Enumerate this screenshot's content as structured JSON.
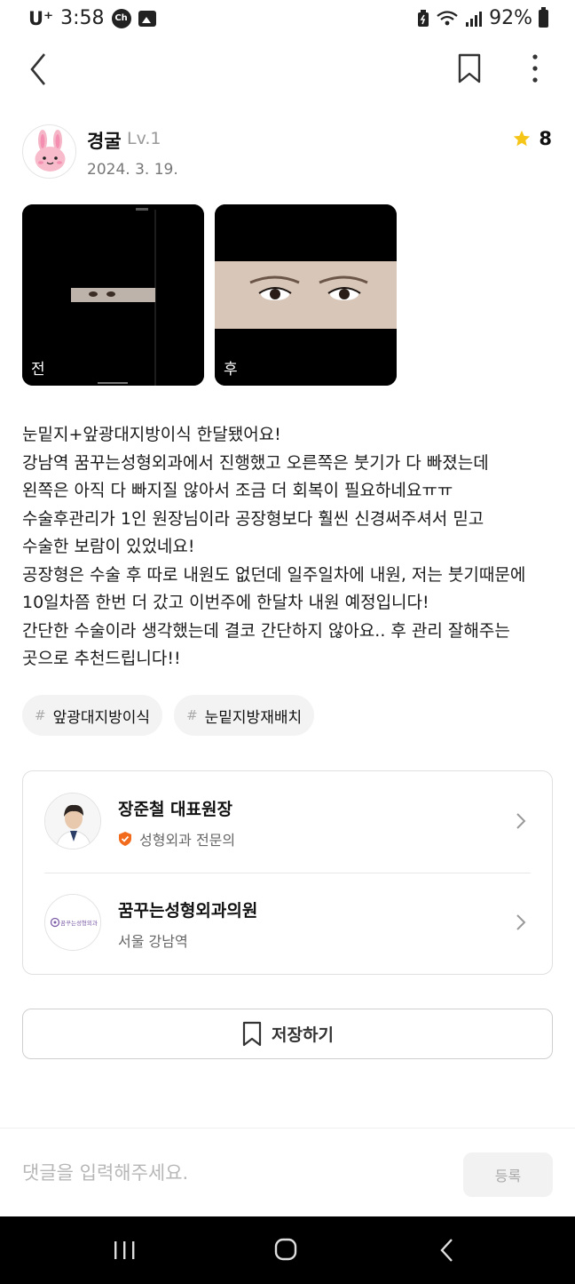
{
  "status_bar": {
    "carrier": "U⁺",
    "time": "3:58",
    "chat_badge": "Ch",
    "battery": "92%"
  },
  "author": {
    "name": "경굴",
    "level": "Lv.1",
    "date": "2024. 3. 19.",
    "rating": "8"
  },
  "photos": [
    {
      "label": "전"
    },
    {
      "label": "후"
    }
  ],
  "body_lines": [
    "눈밑지+앞광대지방이식 한달됐어요!",
    "강남역 꿈꾸는성형외과에서 진행했고 오른쪽은 붓기가 다 빠졌는데",
    "왼쪽은 아직 다 빠지질 않아서 조금 더 회복이 필요하네요ㅠㅠ",
    "수술후관리가 1인 원장님이라 공장형보다 훨씬 신경써주셔서 믿고",
    "수술한 보람이 있었네요!",
    "공장형은 수술 후 따로 내원도 없던데 일주일차에 내원, 저는 붓기때문에",
    "10일차쯤 한번 더 갔고 이번주에 한달차 내원 예정입니다!",
    "간단한 수술이라 생각했는데 결코 간단하지 않아요.. 후 관리 잘해주는",
    "곳으로 추천드립니다!!"
  ],
  "tags": [
    {
      "hash": "#",
      "label": "앞광대지방이식"
    },
    {
      "hash": "#",
      "label": "눈밑지방재배치"
    }
  ],
  "doctor": {
    "name": "장준철 대표원장",
    "specialty": "성형외과 전문의"
  },
  "clinic": {
    "name": "꿈꾸는성형외과의원",
    "location": "서울 강남역",
    "logo_text": "꿈꾸는성형외과"
  },
  "save_label": "저장하기",
  "comment": {
    "placeholder": "댓글을 입력해주세요.",
    "submit_label": "등록"
  },
  "colors": {
    "star": "#F5C518",
    "badge": "#F26A1B",
    "clinic_logo": "#7B5BA6"
  }
}
